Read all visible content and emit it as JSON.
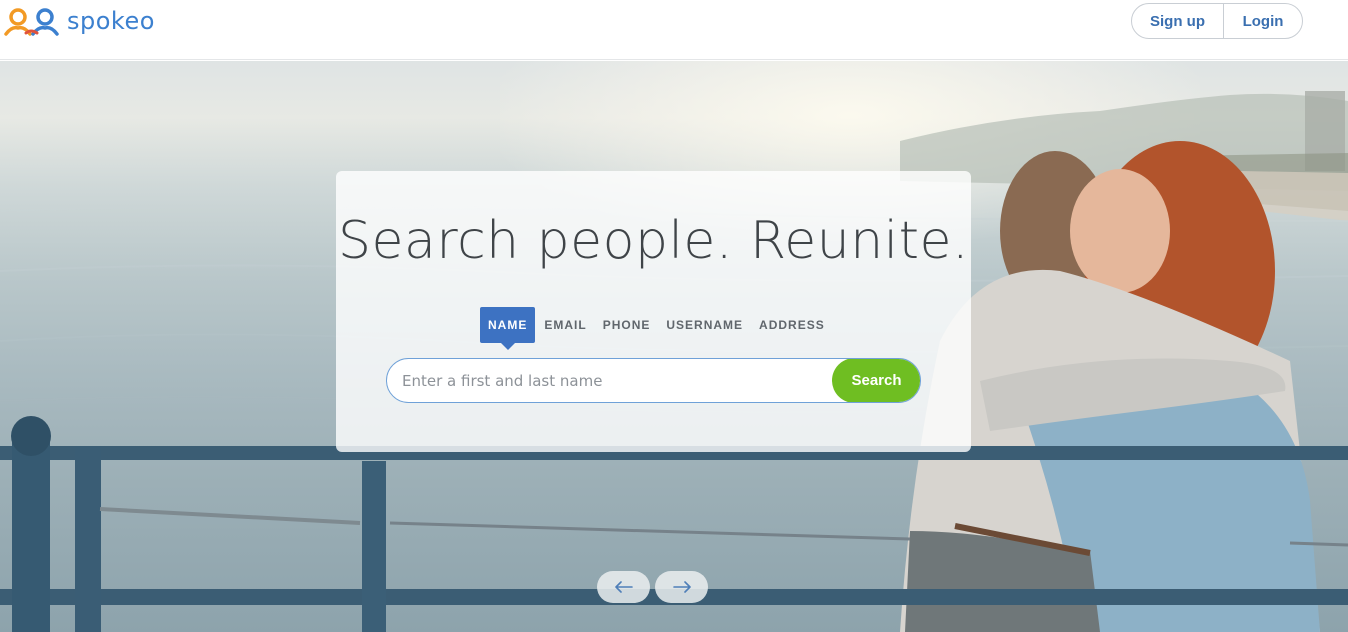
{
  "brand": {
    "name": "spokeo",
    "logo_icon": "two-person-logo-icon"
  },
  "auth": {
    "signup_label": "Sign up",
    "login_label": "Login"
  },
  "hero": {
    "headline": "Search people. Reunite.",
    "tabs": [
      {
        "label": "NAME",
        "active": true
      },
      {
        "label": "EMAIL",
        "active": false
      },
      {
        "label": "PHONE",
        "active": false
      },
      {
        "label": "USERNAME",
        "active": false
      },
      {
        "label": "ADDRESS",
        "active": false
      }
    ],
    "search": {
      "placeholder": "Enter a first and last name",
      "value": "",
      "button_label": "Search"
    },
    "carousel": {
      "prev_icon": "arrow-left-icon",
      "next_icon": "arrow-right-icon"
    }
  },
  "colors": {
    "brand_blue": "#3c80cf",
    "tab_active": "#3d72c2",
    "search_button": "#6fbe22",
    "auth_text": "#3a6fb0"
  }
}
